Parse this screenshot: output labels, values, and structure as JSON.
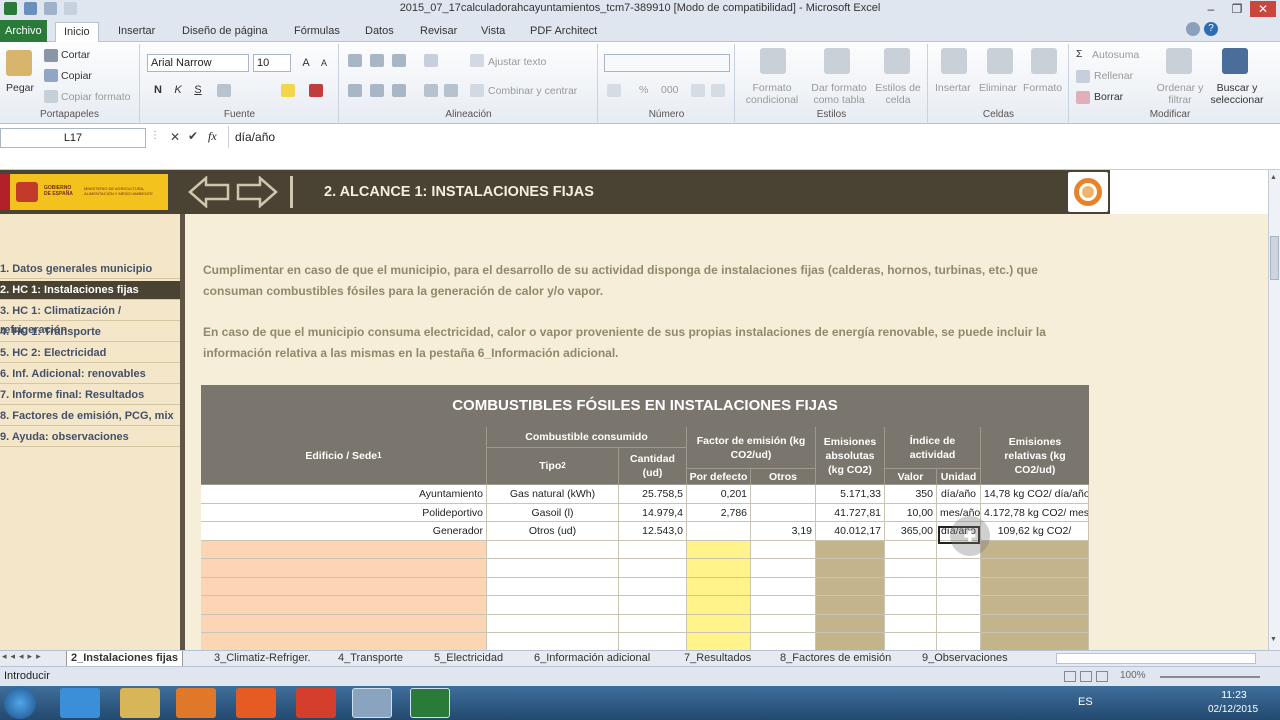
{
  "window": {
    "title": "2015_07_17calculadorahcayuntamientos_tcm7-389910  [Modo de compatibilidad]  -  Microsoft Excel"
  },
  "ribbon_tabs": [
    "Archivo",
    "Inicio",
    "Insertar",
    "Diseño de página",
    "Fórmulas",
    "Datos",
    "Revisar",
    "Vista",
    "PDF Architect"
  ],
  "clipboard": {
    "paste": "Pegar",
    "cut": "Cortar",
    "copy": "Copiar",
    "format_painter": "Copiar formato",
    "group": "Portapapeles"
  },
  "font": {
    "name": "Arial Narrow",
    "size": "10",
    "bold": "N",
    "italic": "K",
    "underline": "S",
    "group": "Fuente"
  },
  "alignment": {
    "wrap": "Ajustar texto",
    "merge": "Combinar y centrar",
    "group": "Alineación"
  },
  "number": {
    "format": "",
    "percent": "%",
    "thousands": "000",
    "group": "Número"
  },
  "styles": {
    "conditional": "Formato condicional",
    "table": "Dar formato como tabla",
    "cell": "Estilos de celda",
    "group": "Estilos"
  },
  "cells": {
    "insert": "Insertar",
    "delete": "Eliminar",
    "format": "Formato",
    "group": "Celdas"
  },
  "editing": {
    "autosum": "Autosuma",
    "fill": "Rellenar",
    "clear": "Borrar",
    "sort": "Ordenar y filtrar",
    "find": "Buscar y seleccionar",
    "group": "Modificar"
  },
  "formula_bar": {
    "name_box": "L17",
    "fx": "fx",
    "content": "día/año"
  },
  "banner": {
    "title": "2. ALCANCE 1: INSTALACIONES FIJAS",
    "gov_line1": "GOBIERNO DE ESPAÑA",
    "gov_line2": "MINISTERIO DE AGRICULTURA, ALIMENTACIÓN Y MEDIO AMBIENTE"
  },
  "nav": [
    {
      "label": "1. Datos generales municipio",
      "active": false
    },
    {
      "label": "2. HC 1: Instalaciones fijas",
      "active": true
    },
    {
      "label": "3. HC 1: Climatización / refrigeración",
      "active": false
    },
    {
      "label": "4. HC 1: Transporte",
      "active": false
    },
    {
      "label": "5. HC 2: Electricidad",
      "active": false
    },
    {
      "label": "6.  Inf. Adicional: renovables",
      "active": false
    },
    {
      "label": "7. Informe final: Resultados",
      "active": false
    },
    {
      "label": "8. Factores de emisión, PCG, mix",
      "active": false
    },
    {
      "label": "9. Ayuda: observaciones",
      "active": false
    }
  ],
  "paragraphs": [
    "Cumplimentar en caso de que el municipio, para el desarrollo de su actividad disponga de instalaciones fijas (calderas, hornos, turbinas, etc.) que",
    "consuman combustibles fósiles para la generación de calor y/o vapor.",
    "En caso de que el municipio consuma electricidad, calor o vapor proveniente de sus propias instalaciones de energía renovable, se puede incluir la",
    "información relativa a las mismas en la pestaña 6_Información adicional."
  ],
  "table": {
    "title": "COMBUSTIBLES FÓSILES EN INSTALACIONES FIJAS",
    "h_edificio": "Edificio / Sede",
    "h_combustible": "Combustible consumido",
    "h_tipo": "Tipo",
    "h_cantidad": "Cantidad (ud)",
    "h_factor": "Factor de emisión (kg CO2/ud)",
    "h_defecto": "Por defecto",
    "h_otros": "Otros",
    "h_emis_abs": "Emisiones absolutas (kg CO2)",
    "h_indice": "Índice de actividad",
    "h_valor": "Valor",
    "h_unidad": "Unidad",
    "h_emis_rel": "Emisiones relativas (kg CO2/ud)",
    "rows": [
      {
        "edificio": "Ayuntamiento",
        "tipo": "Gas natural (kWh)",
        "cantidad": "25.758,5",
        "defecto": "0,201",
        "otros": "",
        "abs": "5.171,33",
        "valor": "350",
        "unidad": "día/año",
        "rel": "14,78 kg CO2/ día/año"
      },
      {
        "edificio": "Polideportivo",
        "tipo": "Gasoil (l)",
        "cantidad": "14.979,4",
        "defecto": "2,786",
        "otros": "",
        "abs": "41.727,81",
        "valor": "10,00",
        "unidad": "mes/año",
        "rel": "4.172,78 kg CO2/ mes/año"
      },
      {
        "edificio": "Generador",
        "tipo": "Otros (ud)",
        "cantidad": "12.543,0",
        "defecto": "",
        "otros": "3,19",
        "abs": "40.012,17",
        "valor": "365,00",
        "unidad": "día/año",
        "rel": "109,62 kg CO2/"
      }
    ]
  },
  "sheet_tabs": [
    "2_Instalaciones fijas",
    "3_Climatiz-Refriger.",
    "4_Transporte",
    "5_Electricidad",
    "6_Información adicional",
    "7_Resultados",
    "8_Factores de emisión",
    "9_Observaciones"
  ],
  "status": {
    "mode": "Introducir",
    "zoom": "100%"
  },
  "taskbar": {
    "lang": "ES",
    "time": "11:23",
    "date": "02/12/2015"
  },
  "colors": {
    "banner": "#4a4232",
    "nav_bg": "#f4e7c9",
    "content_bg": "#f6eed9",
    "header_gray": "#7b766d",
    "input_orange": "#fcd5b4",
    "input_yellow": "#fff38a",
    "calc_khaki": "#c3b48c",
    "excel_green": "#2a7a3a"
  }
}
